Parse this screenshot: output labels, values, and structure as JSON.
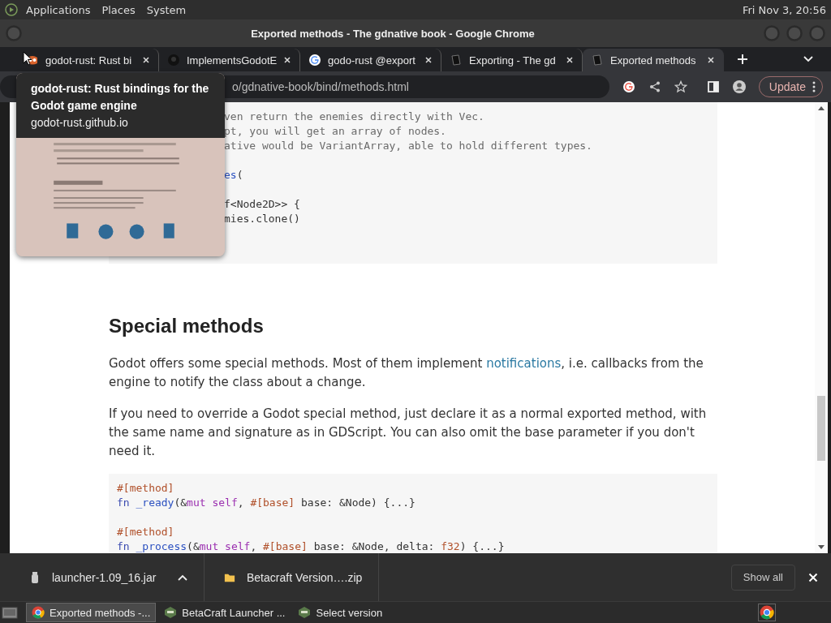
{
  "top_panel": {
    "menus": [
      "Applications",
      "Places",
      "System"
    ],
    "clock": "Fri Nov  3, 20:56"
  },
  "window": {
    "title": "Exported methods - The gdnative book - Google Chrome"
  },
  "tabs": [
    {
      "label": "godot-rust: Rust bi",
      "selected": false
    },
    {
      "label": "ImplementsGodotE",
      "selected": false
    },
    {
      "label": "godo-rust @export",
      "selected": false
    },
    {
      "label": "Exporting - The gd",
      "selected": false
    },
    {
      "label": "Exported methods",
      "selected": true
    }
  ],
  "address_bar": {
    "url": "o/gdnative-book/bind/methods.html",
    "update_button": "Update"
  },
  "tooltip": {
    "title": "godot-rust: Rust bindings for the Godot game engine",
    "url": "godot-rust.github.io"
  },
  "article": {
    "code_top": {
      "groups": [
        [
          [
            {
              "kind": "comment",
              "t": "ven return the enemies directly with Vec."
            }
          ],
          [
            {
              "kind": "comment",
              "t": "pt, you will get an array of nodes."
            }
          ],
          [
            {
              "kind": "comment",
              "t": "ative would be VariantArray, able to hold different types."
            }
          ]
        ],
        [
          [
            {
              "kind": "fn",
              "t": "es"
            },
            {
              "kind": "plain",
              "t": "("
            }
          ]
        ],
        [
          [
            {
              "kind": "plain",
              "t": "f<Node2D>> {"
            }
          ],
          [
            {
              "kind": "plain",
              "t": "mies.clone()"
            }
          ]
        ]
      ]
    },
    "heading": "Special methods",
    "paragraphs": [
      [
        {
          "t": "Godot offers some special methods. Most of them implement ",
          "link": false
        },
        {
          "t": "notifications",
          "link": true
        },
        {
          "t": ", i.e. callbacks from the engine to notify the class about a change.",
          "link": false
        }
      ],
      [
        {
          "t": "If you need to override a Godot special method, just declare it as a normal exported method, with the same name and signature as in GDScript. You can also omit the base parameter if you don't need it.",
          "link": false
        }
      ]
    ],
    "code_bottom": {
      "groups": [
        [
          [
            {
              "kind": "attr",
              "t": "#[method]"
            }
          ],
          [
            {
              "kind": "kw",
              "t": "fn "
            },
            {
              "kind": "fn",
              "t": "_ready"
            },
            {
              "kind": "plain",
              "t": "(&"
            },
            {
              "kind": "kw2",
              "t": "mut "
            },
            {
              "kind": "kw2",
              "t": "self"
            },
            {
              "kind": "plain",
              "t": ", "
            },
            {
              "kind": "attr",
              "t": "#[base]"
            },
            {
              "kind": "plain",
              "t": " base: &Node) {...}"
            }
          ]
        ],
        [
          [
            {
              "kind": "attr",
              "t": "#[method]"
            }
          ],
          [
            {
              "kind": "kw",
              "t": "fn "
            },
            {
              "kind": "fn",
              "t": "_process"
            },
            {
              "kind": "plain",
              "t": "(&"
            },
            {
              "kind": "kw2",
              "t": "mut "
            },
            {
              "kind": "kw2",
              "t": "self"
            },
            {
              "kind": "plain",
              "t": ", "
            },
            {
              "kind": "attr",
              "t": "#[base]"
            },
            {
              "kind": "plain",
              "t": " base: &Node, delta: "
            },
            {
              "kind": "attr",
              "t": "f32"
            },
            {
              "kind": "plain",
              "t": ") {...}"
            }
          ]
        ]
      ]
    }
  },
  "downloads": {
    "items": [
      {
        "name": "launcher-1.09_16.jar"
      },
      {
        "name": "Betacraft Version….zip"
      }
    ],
    "show_all": "Show all"
  },
  "taskbar": {
    "items": [
      {
        "label": "Exported methods -...",
        "selected": true
      },
      {
        "label": "BetaCraft Launcher ...",
        "selected": false
      },
      {
        "label": "Select version",
        "selected": false
      }
    ]
  }
}
